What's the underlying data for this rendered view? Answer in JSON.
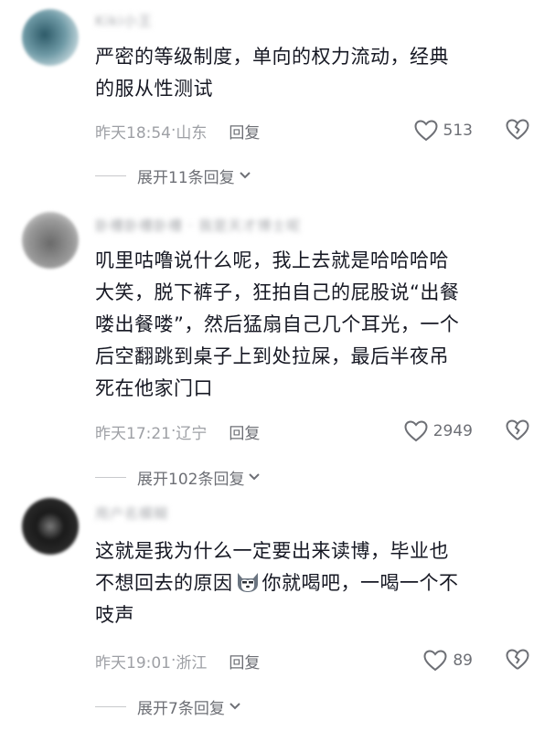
{
  "comments": [
    {
      "username": "Kiki小王",
      "text": "严密的等级制度，单向的权力流动，经典\n的服从性测试",
      "time": "昨天18:54",
      "location": "山东",
      "reply_label": "回复",
      "likes": "513",
      "expand_label": "展开11条回复"
    },
    {
      "username": "卧槽卧槽卧槽 · 我是天才博士呢",
      "text": "叽里咕噜说什么呢，我上去就是哈哈哈哈\n大笑，脱下裤子，狂拍自己的屁股说“出餐\n喽出餐喽”，然后猛扇自己几个耳光，一个\n后空翻跳到桌子上到处拉屎，最后半夜吊\n死在他家门口",
      "time": "昨天17:21",
      "location": "辽宁",
      "reply_label": "回复",
      "likes": "2949",
      "expand_label": "展开102条回复"
    },
    {
      "username": "用户名模糊",
      "text_part1": "这就是我为什么一定要出来读博，毕业也\n不想回去的原因",
      "text_part2": "你就喝吧，一喝一个不\n吱声",
      "emoji": "husky-emoji",
      "time": "昨天19:01",
      "location": "浙江",
      "reply_label": "回复",
      "likes": "89",
      "expand_label": "展开7条回复"
    }
  ],
  "separator": " · "
}
